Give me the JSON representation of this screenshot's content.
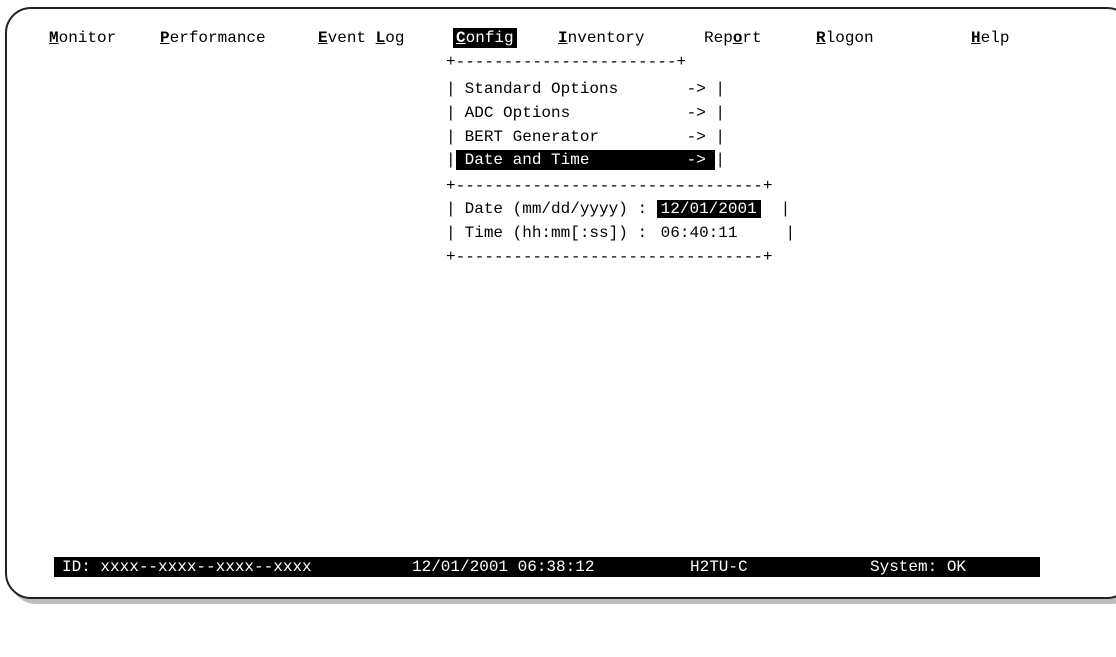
{
  "menu": [
    {
      "hotkey": "M",
      "rest": "onitor"
    },
    {
      "hotkey": "P",
      "rest": "erformance"
    },
    {
      "hotkey": "E",
      "rest": "vent "
    },
    {
      "hotkey": "L",
      "rest": "og"
    },
    {
      "hotkey": "C",
      "rest": "onfig"
    },
    {
      "hotkey": "I",
      "rest": "nventory"
    },
    {
      "pre": "Rep",
      "hotkey": "o",
      "rest": "rt"
    },
    {
      "hotkey": "R",
      "rest": "logon"
    },
    {
      "hotkey": "H",
      "rest": "elp"
    }
  ],
  "dropdown": {
    "border_top": "+-----------------------+",
    "items": [
      {
        "label": "Standard Options",
        "arrow": "->"
      },
      {
        "label": "ADC Options",
        "arrow": "->"
      },
      {
        "label": "BERT Generator",
        "arrow": "->"
      },
      {
        "label": "Date and Time",
        "arrow": "->"
      }
    ]
  },
  "datetime": {
    "border": "+--------------------------------+",
    "date_label": "Date (mm/dd/yyyy) :",
    "date_value": "12/01/2001",
    "time_label": "Time (hh:mm[:ss]) :",
    "time_value": "06:40:11"
  },
  "status": {
    "id": "ID: xxxx--xxxx--xxxx--xxxx",
    "datetime": "12/01/2001 06:38:12",
    "device": "H2TU-C",
    "system": "System: OK"
  },
  "colors": {
    "background": "#ffffff",
    "highlight": "#000000"
  }
}
